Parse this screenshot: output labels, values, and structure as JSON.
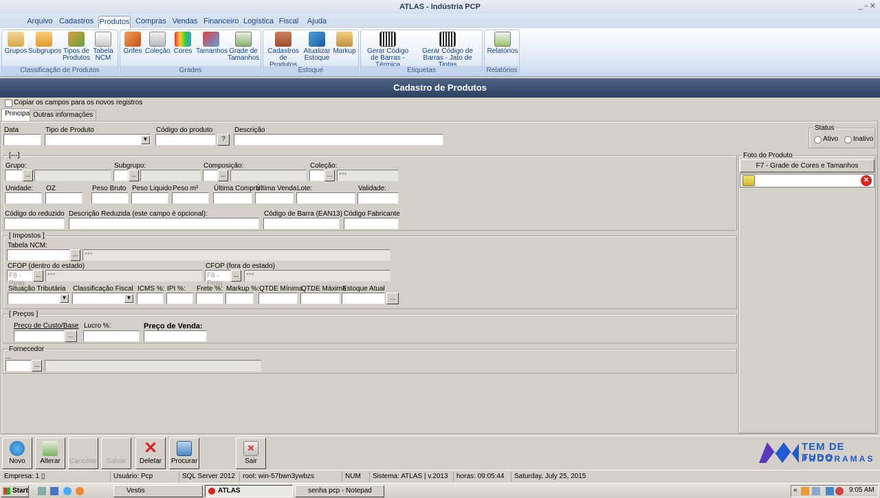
{
  "window": {
    "title": "ATLAS - Indústria PCP",
    "controls": "_ ▫ ✕"
  },
  "menu": [
    "Arquivo",
    "Cadastros",
    "Produtos",
    "Compras",
    "Vendas",
    "Financeiro",
    "Logística",
    "Fiscal",
    "Ajuda"
  ],
  "menu_active": "Produtos",
  "ribbon": {
    "groups": [
      {
        "label": "Classificação de Produtos",
        "buttons": [
          "Grupos",
          "Subgrupos",
          "Tipos de Produtos",
          "Tabela NCM"
        ]
      },
      {
        "label": "Grades",
        "buttons": [
          "Grifes",
          "Coleção",
          "Cores",
          "Tamanhos",
          "Grade de Tamanhos"
        ]
      },
      {
        "label": "Estoque",
        "buttons": [
          "Cadastros de Produtos",
          "Atualizar Estoque",
          "Markup"
        ]
      },
      {
        "label": "Etiquetas",
        "buttons": [
          "Gerar Código de Barras - Térmica",
          "Gerar Código de Barras - Jato de Tintas"
        ]
      },
      {
        "label": "Relatórios",
        "buttons": [
          "Relatórios"
        ]
      }
    ]
  },
  "form": {
    "header": "Cadastro de Produtos",
    "copy_fields_label": "Copiar os campos para os novos registros",
    "tabs": [
      "Principal",
      "Outras informações"
    ],
    "top": {
      "data": "Data",
      "tipo_produto": "Tipo de Produto",
      "codigo_produto": "Código do produto",
      "codigo_btn": "?",
      "descricao": "Descrição"
    },
    "status": {
      "title": "Status",
      "ativo": "Ativo",
      "inativo": "Inativo"
    },
    "group1": {
      "title": "[---]",
      "grupo": "Grupo:",
      "subgrupo": "Subgrupo:",
      "composicao": "Composição:",
      "colecao": "Coleção:",
      "colecao_value": "***",
      "unidade": "Unidade:",
      "oz": "OZ",
      "peso_bruto": "Peso Bruto",
      "peso_liquido": "Peso Liquido",
      "peso_m2": "Peso m²",
      "ultima_compra": "Última Compra",
      "ultima_venda": "Última Venda",
      "lote": "Lote:",
      "validade": "Validade:",
      "codigo_reduzido": "Código do reduzido",
      "descricao_reduzida": "Descrição Reduzida (este campo é opcional):",
      "codigo_barra": "Código de Barra (EAN13)",
      "codigo_fabricante": "Código Fabricante"
    },
    "impostos": {
      "title": "[ Impostos ]",
      "tabela_ncm": "Tabela NCM:",
      "ncm_value": "***",
      "cfop_dentro": "CFOP (dentro do estado)",
      "cfop_fora": "CFOP (fora do estado)",
      "cfop_placeholder": "F8 - Pesq",
      "cfop_value": "***",
      "situacao": "Situação Tributária",
      "classificacao": "Classificação Fiscal",
      "icms": "ICMS %:",
      "ipi": "IPI %:",
      "frete": "Frete %:",
      "markup": "Markup %:",
      "qtde_min": "QTDE Mínima",
      "qtde_max": "QTDE Máxima",
      "estoque_atual": "Estoque Atual"
    },
    "precos": {
      "title": "[ Preços ]",
      "custo": "Preço de Custo/Base",
      "lucro": "Lucro %:",
      "venda": "Preço de Venda:"
    },
    "fornecedor": {
      "title": "Fornecedor",
      "hint": "..."
    },
    "foto": {
      "title": "Foto do Produto",
      "grade_btn": "F7 - Grade de Cores e Tamanhos"
    }
  },
  "toolbar": [
    "Novo",
    "Alterar",
    "Cancelar",
    "Salvar",
    "Deletar",
    "Procurar",
    "Sair"
  ],
  "logo": {
    "line1": "TEM DE TUDO",
    "line2": "PROGRAMAS"
  },
  "status_bar": [
    "Empresa: 1 ▯",
    "Usuário: Pcp",
    "SQL Server 2012",
    "root: win-57bwn3ywbzs",
    "NUM",
    "Sistema: ATLAS | v.2013",
    "horas: 09:05:44",
    "Saturday, July 25, 2015"
  ],
  "taskbar": {
    "start": "Start",
    "tasks": [
      "Vestis",
      "ATLAS",
      "senha pcp - Notepad"
    ],
    "clock": "9:05 AM"
  },
  "colors": {
    "ribbon_text": "#15428b",
    "header_bg": "#3a4f72",
    "delete_red": "#d9241c",
    "logo_blue": "#1e5ccf"
  }
}
